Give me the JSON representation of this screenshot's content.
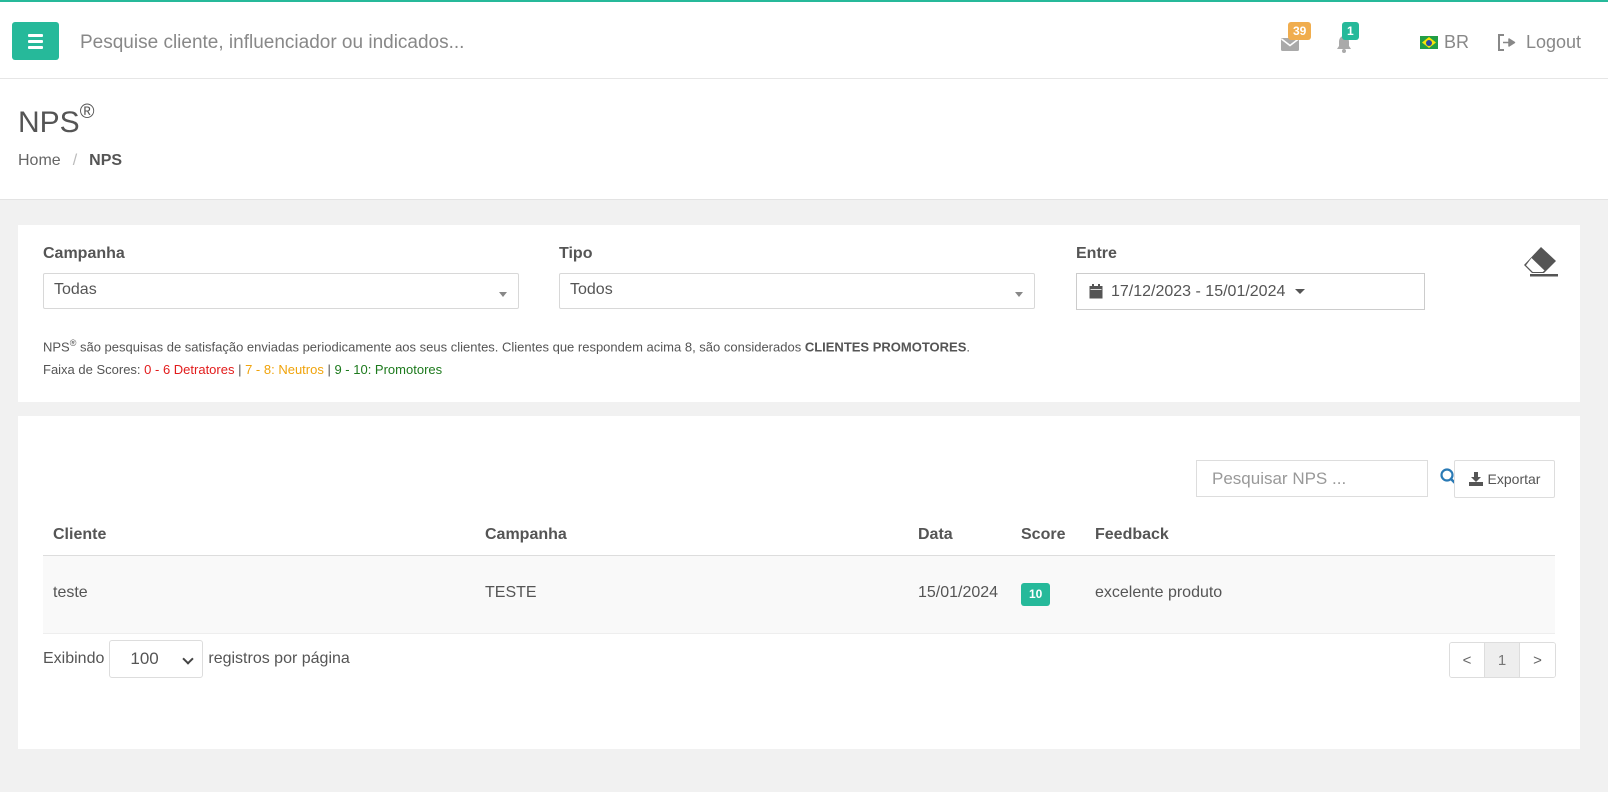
{
  "topbar": {
    "search_placeholder": "Pesquise cliente, influenciador ou indicados...",
    "messages_count": "39",
    "notifications_count": "1",
    "language": "BR",
    "logout_label": "Logout",
    "accent_color": "#26b99a",
    "messages_badge_color": "#f0ad4e"
  },
  "page": {
    "title": "NPS",
    "title_mark": "®",
    "breadcrumb": {
      "home": "Home",
      "separator": "/",
      "current": "NPS"
    }
  },
  "filters": {
    "campanha_label": "Campanha",
    "campanha_value": "Todas",
    "tipo_label": "Tipo",
    "tipo_value": "Todos",
    "entre_label": "Entre",
    "date_range": "17/12/2023 - 15/01/2024",
    "info_prefix": "NPS",
    "info_mark": "®",
    "info_text": " são pesquisas de satisfação enviadas periodicamente aos seus clientes. Clientes que respondem acima 8, são considerados ",
    "info_bold": "CLIENTES PROMOTORES",
    "info_end": ".",
    "scores_label": "Faixa de Scores: ",
    "score_detratores": "0 - 6 Detratores",
    "score_sep": " | ",
    "score_neutros": "7 - 8: Neutros",
    "score_promotores": "9 - 10: Promotores"
  },
  "table": {
    "search_placeholder": "Pesquisar NPS ...",
    "export_label": "Exportar",
    "headers": [
      "Cliente",
      "Campanha",
      "Data",
      "Score",
      "Feedback"
    ],
    "rows": [
      [
        "teste",
        "TESTE",
        "15/01/2024",
        "10",
        "excelente produto"
      ]
    ],
    "length_prefix": "Exibindo",
    "length_value": "100",
    "length_suffix": "registros por página",
    "pager": {
      "prev": "<",
      "page": "1",
      "next": ">"
    }
  }
}
